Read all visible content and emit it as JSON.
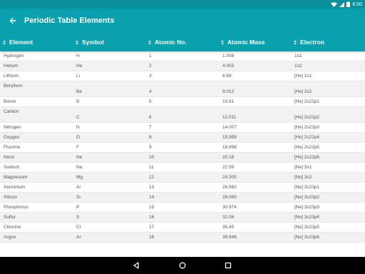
{
  "status_bar": {
    "time": "6:00",
    "icons": [
      "wifi-icon",
      "signal-icon",
      "battery-icon"
    ]
  },
  "app_bar": {
    "title": "Periodic Table Elements",
    "back_icon": "arrow-left-icon"
  },
  "table": {
    "columns": [
      "Element",
      "Symbol",
      "Atomic No.",
      "Atomic Mass",
      "Electron"
    ],
    "rows": [
      [
        "Hydrogen",
        "H",
        "1",
        "1.008",
        "1s1"
      ],
      [
        "Helium",
        "He",
        "2",
        "4.003",
        "1s2"
      ],
      [
        "Lithium",
        "Li",
        "3",
        "6.94",
        "[He] 2s1"
      ],
      [
        "Beryllium",
        "Be",
        "4",
        "9.012",
        "[He] 2s2"
      ],
      [
        "Boron",
        "B",
        "5",
        "10.81",
        "[He] 2s22p1"
      ],
      [
        "Carbon",
        "C",
        "6",
        "12.011",
        "[He] 2s22p2"
      ],
      [
        "Nitrogen",
        "N",
        "7",
        "14.007",
        "[He] 2s22p3"
      ],
      [
        "Oxygen",
        "O",
        "8",
        "15.999",
        "[He] 2s22p4"
      ],
      [
        "Fluorine",
        "F",
        "9",
        "18.998",
        "[He] 2s22p5"
      ],
      [
        "Neon",
        "Ne",
        "10",
        "20.18",
        "[He] 2s22p6"
      ],
      [
        "Sodium",
        "Na",
        "11",
        "22.99",
        "[Ne] 3s1"
      ],
      [
        "Magnesium",
        "Mg",
        "12",
        "24.305",
        "[Ne] 3s2"
      ],
      [
        "Aluminium",
        "Al",
        "13",
        "26.982",
        "[Ne] 3s23p1"
      ],
      [
        "Silicon",
        "Si",
        "14",
        "28.085",
        "[Ne] 3s23p2"
      ],
      [
        "Phosphorus",
        "P",
        "15",
        "30.974",
        "[Ne] 3s23p3"
      ],
      [
        "Sulfur",
        "S",
        "16",
        "32.06",
        "[Ne] 3s23p4"
      ],
      [
        "Chlorine",
        "Cl",
        "17",
        "35.45",
        "[Ne] 3s23p5"
      ],
      [
        "Argon",
        "Ar",
        "18",
        "39.948",
        "[Ne] 3s23p6"
      ]
    ]
  },
  "nav_bar": {
    "icons": [
      "back-triangle-icon",
      "home-circle-icon",
      "recents-square-icon"
    ]
  },
  "colors": {
    "primary": "#0aa0ad",
    "status_bar": "#0a8f9b",
    "nav_bar": "#000000",
    "row_alt": "#f2f2f2"
  }
}
